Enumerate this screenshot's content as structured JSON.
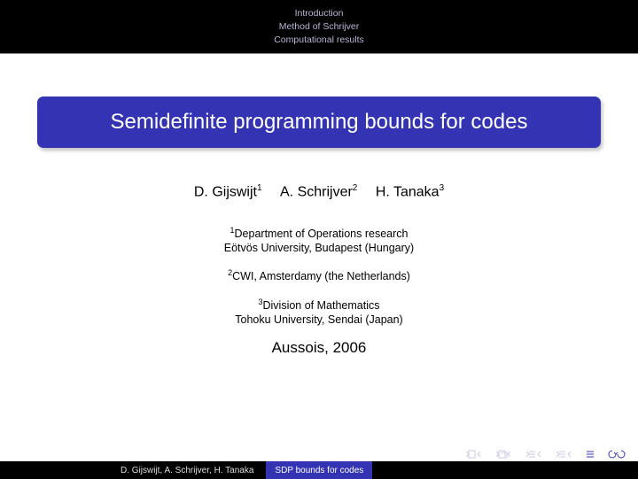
{
  "header": {
    "nav": [
      "Introduction",
      "Method of Schrijver",
      "Computational results"
    ]
  },
  "title": "Semidefinite programming bounds for codes",
  "authors": [
    {
      "name": "D. Gijswijt",
      "mark": "1"
    },
    {
      "name": "A. Schrijver",
      "mark": "2"
    },
    {
      "name": "H. Tanaka",
      "mark": "3"
    }
  ],
  "affiliations": [
    {
      "mark": "1",
      "lines": [
        "Department of Operations research",
        "Eötvös University, Budapest (Hungary)"
      ]
    },
    {
      "mark": "2",
      "lines": [
        "CWI, Amsterdamy (the Netherlands)"
      ]
    },
    {
      "mark": "3",
      "lines": [
        "Division of Mathematics",
        "Tohoku University, Sendai (Japan)"
      ]
    }
  ],
  "venue": "Aussois, 2006",
  "footer": {
    "authors": "D. Gijswijt, A. Schrijver, H. Tanaka",
    "short_title": "SDP bounds for codes"
  },
  "nav_icons": {
    "mode": "≡",
    "undo": "↺↷"
  }
}
